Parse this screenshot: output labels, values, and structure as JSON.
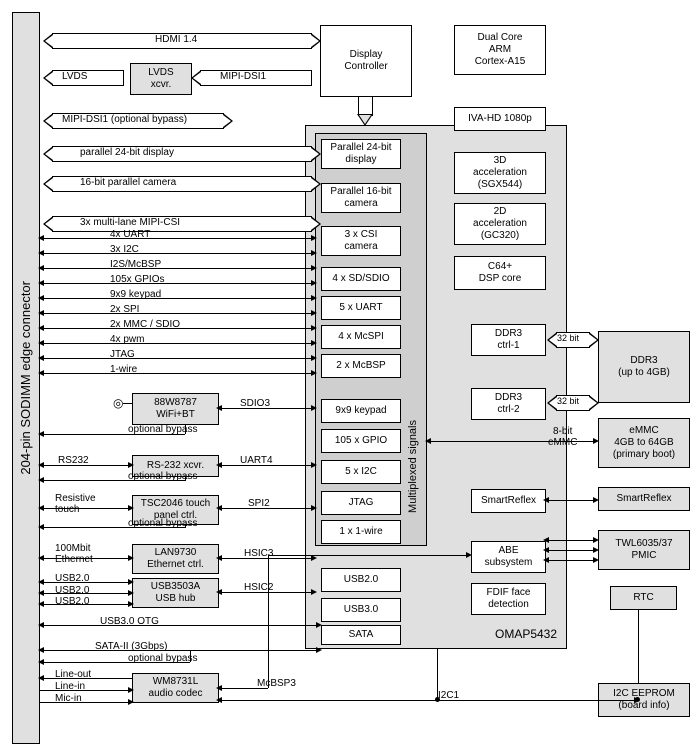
{
  "edge_connector": "204-pin SODIMM edge connector",
  "soc_label": "OMAP5432",
  "mux_label": "Multiplexed signals",
  "display_ctrl": "Display\nController",
  "lvds_xcvr": "LVDS\nxcvr.",
  "int_blocks": [
    "Parallel 24-bit\ndisplay",
    "Parallel 16-bit\ncamera",
    "3 x CSI\ncamera",
    "4 x SD/SDIO",
    "5 x UART",
    "4 x McSPI",
    "2 x McBSP",
    "9x9 keypad",
    "105 x GPIO",
    "5 x I2C",
    "JTAG",
    "1 x 1-wire"
  ],
  "under_blocks": [
    "USB2.0",
    "USB3.0",
    "SATA"
  ],
  "right_col": [
    "Dual Core\nARM\nCortex-A15",
    "IVA-HD 1080p",
    "3D\nacceleration\n(SGX544)",
    "2D\nacceleration\n(GC320)",
    "C64+\nDSP core",
    "DDR3\nctrl-1",
    "DDR3\nctrl-2",
    "SmartReflex",
    "ABE\nsubsystem",
    "FDIF face\ndetection"
  ],
  "far_right": {
    "ddr3": "DDR3\n(up to 4GB)",
    "emmc": "eMMC\n4GB to 64GB\n(primary boot)",
    "smartreflex": "SmartReflex",
    "pmic": "TWL6035/37\nPMIC",
    "rtc": "RTC",
    "eeprom": "I2C EEPROM\n(board info)"
  },
  "ext_chips": {
    "wifi": "88W8787\nWiFi+BT",
    "rs232": "RS-232 xcvr.",
    "touch": "TSC2046 touch\npanel ctrl.",
    "lan": "LAN9730\nEthernet ctrl.",
    "usbhub": "USB3503A\nUSB hub",
    "audio": "WM8731L\naudio codec"
  },
  "signals_top": {
    "hdmi": "HDMI 1.4",
    "lvds": "LVDS",
    "mipi_dsi1a": "MIPI-DSI1",
    "mipi_dsi1b": "MIPI-DSI1 (optional bypass)",
    "p24": "parallel 24-bit display",
    "p16": "16-bit parallel camera",
    "csi3x": "3x multi-lane MIPI-CSI"
  },
  "muxed_signals": [
    "4x UART",
    "3x I2C",
    "I2S/McBSP",
    "105x GPIOs",
    "9x9 keypad",
    "2x SPI",
    "2x MMC / SDIO",
    "4x pwm",
    "JTAG",
    "1-wire"
  ],
  "ext_labels": {
    "sdio3": "SDIO3",
    "opt_bypass": "optional bypass",
    "rs232l": "RS232",
    "uart4": "UART4",
    "restouch": "Resistive\ntouch",
    "spi2": "SPI2",
    "eth": "100Mbit\nEthernet",
    "hsic3": "HSIC3",
    "hsic2": "HSIC2",
    "usb20": "USB2.0",
    "usb30otg": "USB3.0 OTG",
    "sata": "SATA-II (3Gbps)",
    "lineout": "Line-out",
    "linein": "Line-in",
    "micin": "Mic-in",
    "mcbsp3": "McBSP3",
    "i2c1": "I2C1",
    "ddr32bit": "32 bit",
    "emmc8": "8-bit\neMMC"
  }
}
